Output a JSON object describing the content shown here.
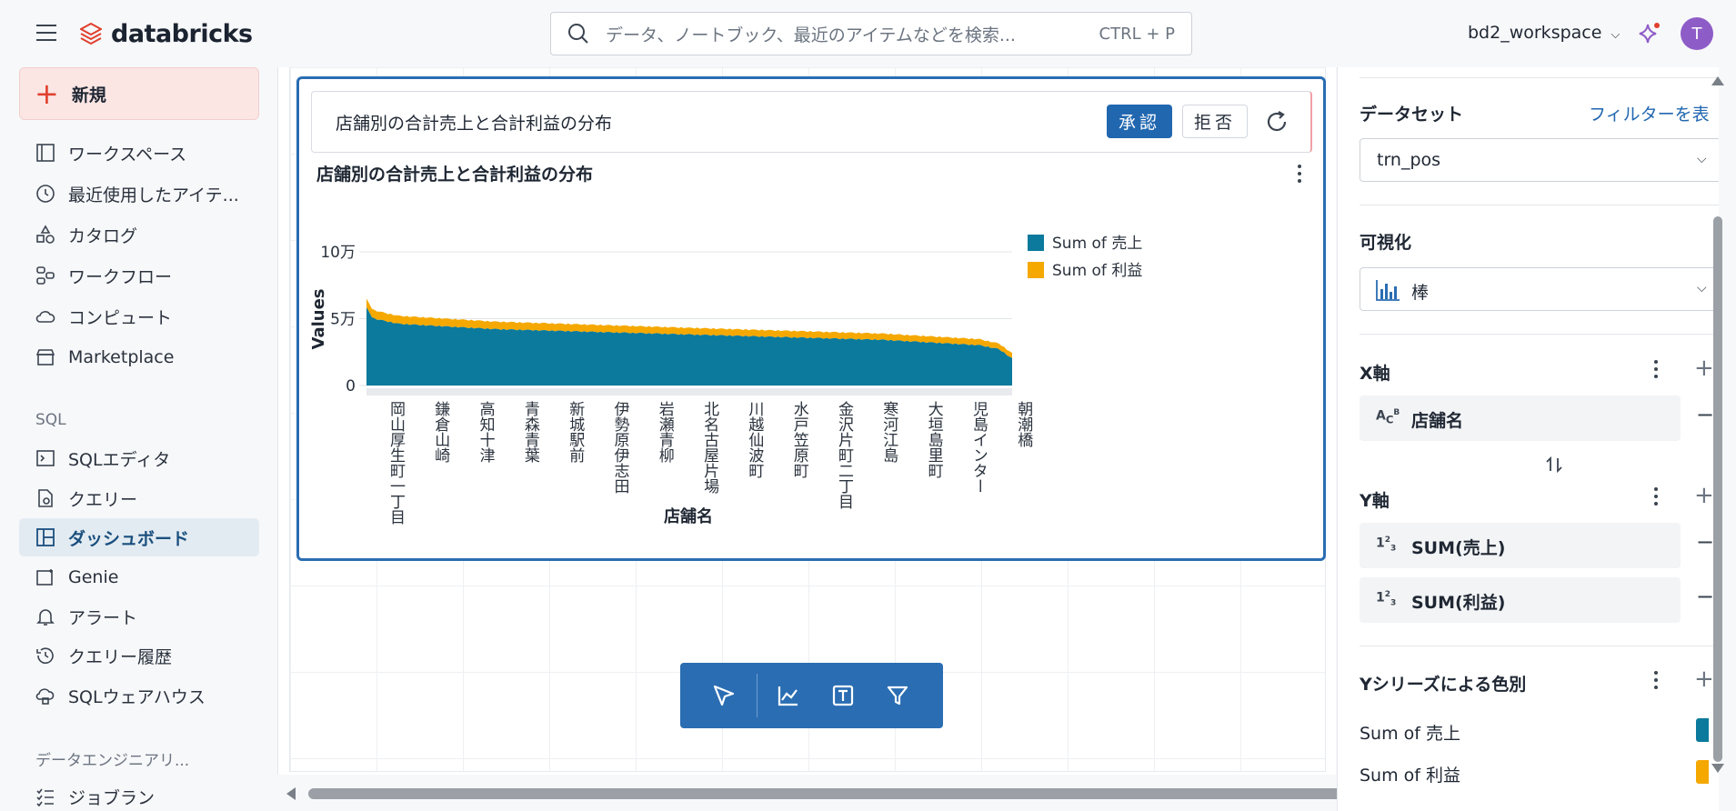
{
  "header": {
    "brand": "databricks",
    "search_placeholder": "データ、ノートブック、最近のアイテムなどを検索...",
    "search_shortcut": "CTRL + P",
    "workspace": "bd2_workspace",
    "avatar_initial": "T",
    "brand_color": "#e0402e"
  },
  "sidebar": {
    "new_label": "新規",
    "items": [
      {
        "label": "ワークスペース",
        "icon": "workspace-icon"
      },
      {
        "label": "最近使用したアイテ...",
        "icon": "clock-icon"
      },
      {
        "label": "カタログ",
        "icon": "catalog-icon"
      },
      {
        "label": "ワークフロー",
        "icon": "workflow-icon"
      },
      {
        "label": "コンピュート",
        "icon": "cloud-icon"
      },
      {
        "label": "Marketplace",
        "icon": "store-icon"
      }
    ],
    "sql_section": "SQL",
    "sql_items": [
      {
        "label": "SQLエディタ",
        "icon": "terminal-icon"
      },
      {
        "label": "クエリー",
        "icon": "query-icon"
      },
      {
        "label": "ダッシュボード",
        "icon": "dashboard-icon",
        "active": true
      },
      {
        "label": "Genie",
        "icon": "genie-icon"
      },
      {
        "label": "アラート",
        "icon": "bell-icon"
      },
      {
        "label": "クエリー履歴",
        "icon": "history-icon"
      },
      {
        "label": "SQLウェアハウス",
        "icon": "warehouse-icon"
      }
    ],
    "de_section": "データエンジニアリ...",
    "de_items": [
      {
        "label": "ジョブラン",
        "icon": "job-runs-icon"
      }
    ]
  },
  "widget": {
    "prompt": "店舗別の合計売上と合計利益の分布",
    "approve_label": "承認",
    "reject_label": "拒否"
  },
  "chart_data": {
    "type": "area",
    "stacked": true,
    "title": "店舗別の合計売上と合計利益の分布",
    "xlabel": "店舗名",
    "ylabel": "Values",
    "y_ticks": [
      "0",
      "5万",
      "10万"
    ],
    "ylim": [
      0,
      100000
    ],
    "x_tick_labels": [
      "岡山厚生町一丁目",
      "鎌倉山崎",
      "高知十津",
      "青森青葉",
      "新城駅前",
      "伊勢原伊志田",
      "岩瀬青柳",
      "北名古屋片場",
      "川越仙波町",
      "水戸笠原町",
      "金沢片町二丁目",
      "寒河江島",
      "大垣島里町",
      "児島インター",
      "朝潮橋"
    ],
    "series": [
      {
        "name": "Sum of 売上",
        "color": "#0b7a9c",
        "profile": [
          [
            0,
            58000
          ],
          [
            0.01,
            50000
          ],
          [
            0.05,
            46000
          ],
          [
            0.2,
            42000
          ],
          [
            0.5,
            38000
          ],
          [
            0.8,
            34000
          ],
          [
            0.95,
            30000
          ],
          [
            0.98,
            27000
          ],
          [
            1.0,
            20000
          ]
        ]
      },
      {
        "name": "Sum of 利益",
        "color": "#f5a800",
        "profile": [
          [
            0,
            6500
          ],
          [
            0.03,
            6000
          ],
          [
            0.5,
            5000
          ],
          [
            0.95,
            4500
          ],
          [
            1.0,
            4000
          ]
        ]
      }
    ],
    "legend_position": "top-right",
    "grid": true
  },
  "toolbar": {
    "tools": [
      "select-tool-icon",
      "visualization-tool-icon",
      "text-tool-icon",
      "filter-tool-icon"
    ]
  },
  "panel": {
    "dataset_label": "データセット",
    "filter_link": "フィルターを表",
    "dataset_value": "trn_pos",
    "viz_label": "可視化",
    "viz_value": "棒",
    "x_axis_label": "X軸",
    "x_field": "店舗名",
    "y_axis_label": "Y軸",
    "y_fields": [
      "SUM(売上)",
      "SUM(利益)"
    ],
    "color_label": "Yシリーズによる色別",
    "color_items": [
      "Sum of 売上",
      "Sum of 利益"
    ]
  }
}
